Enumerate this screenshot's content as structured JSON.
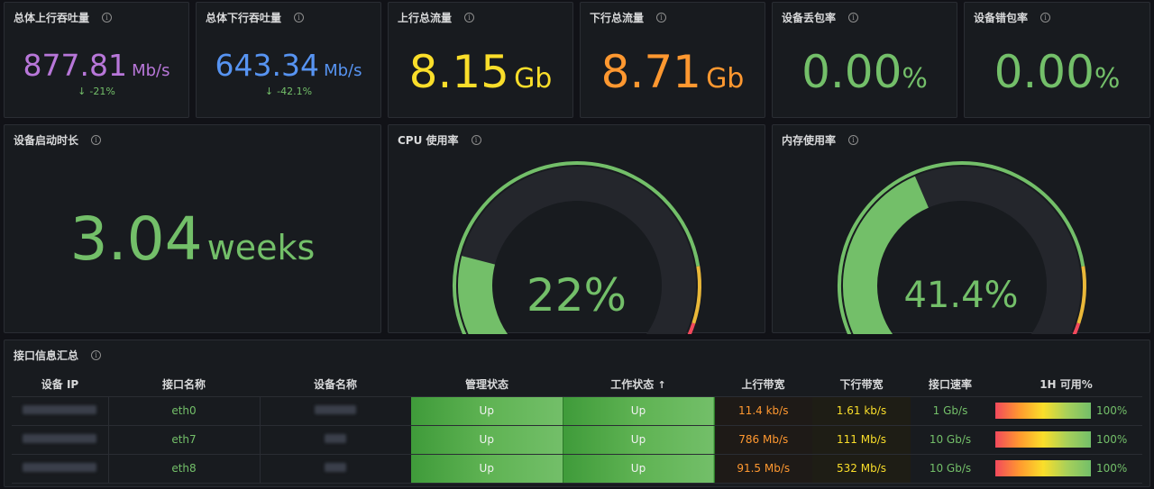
{
  "stats": [
    {
      "title": "总体上行吞吐量",
      "value": "877.81",
      "unit": "Mb/s",
      "color": "#b877d9",
      "delta": "-21%"
    },
    {
      "title": "总体下行吞吐量",
      "value": "643.34",
      "unit": "Mb/s",
      "color": "#5794f2",
      "delta": "-42.1%"
    },
    {
      "title": "上行总流量",
      "value": "8.15",
      "unit": "Gb",
      "color": "#fade2a"
    },
    {
      "title": "下行总流量",
      "value": "8.71",
      "unit": "Gb",
      "color": "#ff9830"
    },
    {
      "title": "设备丢包率",
      "value": "0.00",
      "unit": "%",
      "color": "#73bf69"
    },
    {
      "title": "设备错包率",
      "value": "0.00",
      "unit": "%",
      "color": "#73bf69"
    }
  ],
  "uptime": {
    "title": "设备启动时长",
    "value": "3.04",
    "unit": "weeks",
    "color": "#73bf69"
  },
  "cpu": {
    "title": "CPU 使用率",
    "value": "22%",
    "percent": 22
  },
  "mem": {
    "title": "内存使用率",
    "value": "41.4%",
    "percent": 41.4
  },
  "thresholds": {
    "green": "#73bf69",
    "yellow": "#eab839",
    "red": "#f2495c"
  },
  "table": {
    "title": "接口信息汇总",
    "headers": [
      "设备 IP",
      "接口名称",
      "设备名称",
      "管理状态",
      "工作状态",
      "上行带宽",
      "下行带宽",
      "接口速率",
      "1H 可用%"
    ],
    "sort_arrow": "↑",
    "rows": [
      {
        "iface": "eth0",
        "admin": "Up",
        "oper": "Up",
        "up_bw": "11.4 kb/s",
        "down_bw": "1.61 kb/s",
        "speed": "1 Gb/s",
        "avail": "100%"
      },
      {
        "iface": "eth7",
        "admin": "Up",
        "oper": "Up",
        "up_bw": "786 Mb/s",
        "down_bw": "111 Mb/s",
        "speed": "10 Gb/s",
        "avail": "100%"
      },
      {
        "iface": "eth8",
        "admin": "Up",
        "oper": "Up",
        "up_bw": "91.5 Mb/s",
        "down_bw": "532 Mb/s",
        "speed": "10 Gb/s",
        "avail": "100%"
      }
    ],
    "colors": {
      "iface": "#73bf69",
      "up_bw": "#ff9830",
      "down_bw": "#fade2a",
      "speed": "#73bf69",
      "avail": "#73bf69"
    }
  }
}
